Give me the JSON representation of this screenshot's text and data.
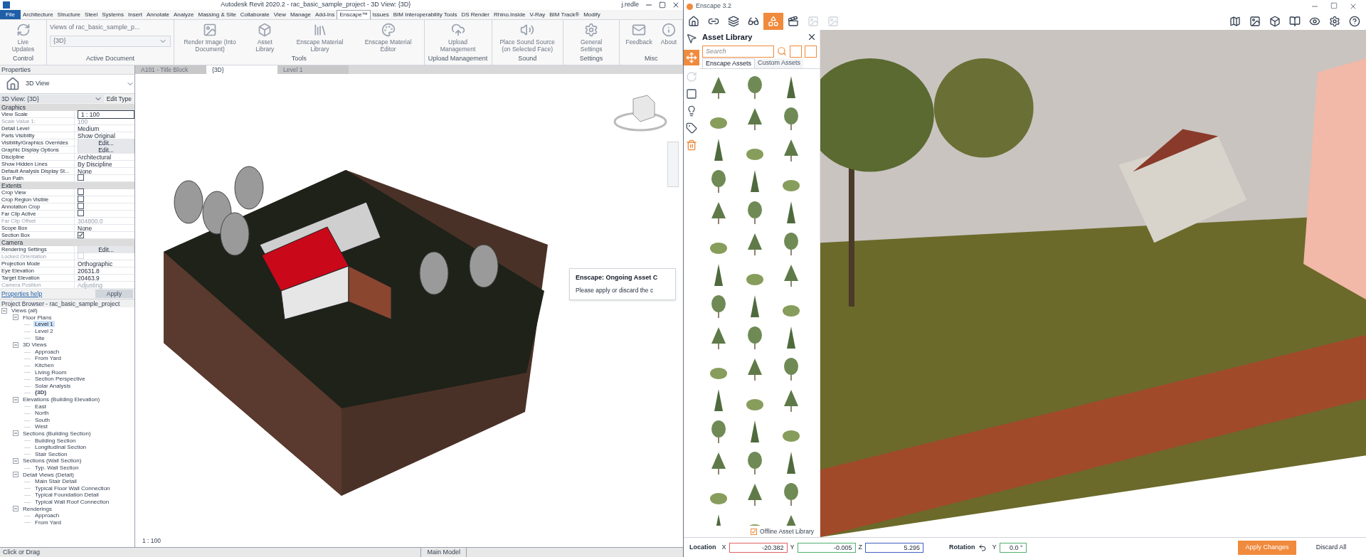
{
  "revit": {
    "title": "Autodesk Revit 2020.2 - rac_basic_sample_project - 3D View: {3D}",
    "user": "j.redle",
    "ribbon_tabs": [
      {
        "label": "File",
        "selected": false,
        "kind": "file"
      },
      {
        "label": "Architecture",
        "selected": false,
        "kind": "tab"
      },
      {
        "label": "Structure",
        "selected": false,
        "kind": "tab"
      },
      {
        "label": "Steel",
        "selected": false,
        "kind": "tab"
      },
      {
        "label": "Systems",
        "selected": false,
        "kind": "tab"
      },
      {
        "label": "Insert",
        "selected": false,
        "kind": "tab"
      },
      {
        "label": "Annotate",
        "selected": false,
        "kind": "tab"
      },
      {
        "label": "Analyze",
        "selected": false,
        "kind": "tab"
      },
      {
        "label": "Massing & Site",
        "selected": false,
        "kind": "tab"
      },
      {
        "label": "Collaborate",
        "selected": false,
        "kind": "tab"
      },
      {
        "label": "View",
        "selected": false,
        "kind": "tab"
      },
      {
        "label": "Manage",
        "selected": false,
        "kind": "tab"
      },
      {
        "label": "Add-Ins",
        "selected": false,
        "kind": "tab"
      },
      {
        "label": "Enscape™",
        "selected": true,
        "kind": "tab"
      },
      {
        "label": "Issues",
        "selected": false,
        "kind": "tab"
      },
      {
        "label": "BIM Interoperability Tools",
        "selected": false,
        "kind": "tab"
      },
      {
        "label": "DS Render",
        "selected": false,
        "kind": "tab"
      },
      {
        "label": "Rhino.Inside",
        "selected": false,
        "kind": "tab"
      },
      {
        "label": "V-Ray",
        "selected": false,
        "kind": "tab"
      },
      {
        "label": "BIM Track®",
        "selected": false,
        "kind": "tab"
      },
      {
        "label": "Modify",
        "selected": false,
        "kind": "tab"
      }
    ],
    "ribbon_panels": [
      {
        "label": "Control",
        "kind": "tools",
        "tools": [
          {
            "label": "Live Updates"
          }
        ]
      },
      {
        "label": "Active Document",
        "kind": "document",
        "caption": "Views of  rac_basic_sample_p...",
        "value": "{3D}"
      },
      {
        "label": "Tools",
        "kind": "tools",
        "tools": [
          {
            "label": "Render Image (Into Document)"
          },
          {
            "label": "Asset Library"
          },
          {
            "label": "Enscape Material Library"
          },
          {
            "label": "Enscape Material Editor"
          }
        ]
      },
      {
        "label": "Upload Management",
        "kind": "tools",
        "tools": [
          {
            "label": "Upload Management"
          }
        ]
      },
      {
        "label": "Sound",
        "kind": "tools",
        "tools": [
          {
            "label": "Place Sound Source (on Selected Face)"
          }
        ]
      },
      {
        "label": "Settings",
        "kind": "tools",
        "tools": [
          {
            "label": "General Settings"
          }
        ]
      },
      {
        "label": "Misc",
        "kind": "tools",
        "tools": [
          {
            "label": "Feedback"
          },
          {
            "label": "About"
          }
        ]
      }
    ],
    "properties": {
      "title": "Properties",
      "type_name": "3D View",
      "view_selector": "3D View: {3D}",
      "edit_type": "Edit Type",
      "sections": [
        {
          "name": "Graphics",
          "rows": [
            {
              "label": "View Scale",
              "value": "1 : 100",
              "kind": "field",
              "disabled": false
            },
            {
              "label": "Scale Value    1:",
              "value": "100",
              "kind": "text",
              "disabled": true
            },
            {
              "label": "Detail Level",
              "value": "Medium",
              "kind": "text",
              "disabled": false
            },
            {
              "label": "Parts Visibility",
              "value": "Show Original",
              "kind": "text",
              "disabled": false
            },
            {
              "label": "Visibility/Graphics Overrides",
              "value": "Edit...",
              "kind": "button",
              "disabled": false
            },
            {
              "label": "Graphic Display Options",
              "value": "Edit...",
              "kind": "button",
              "disabled": false
            },
            {
              "label": "Discipline",
              "value": "Architectural",
              "kind": "text",
              "disabled": false
            },
            {
              "label": "Show Hidden Lines",
              "value": "By Discipline",
              "kind": "text",
              "disabled": false
            },
            {
              "label": "Default Analysis Display St...",
              "value": "None",
              "kind": "text",
              "disabled": false
            },
            {
              "label": "Sun Path",
              "kind": "checkbox",
              "disabled": false,
              "checked": false
            }
          ]
        },
        {
          "name": "Extents",
          "rows": [
            {
              "label": "Crop View",
              "kind": "checkbox",
              "disabled": false,
              "checked": false
            },
            {
              "label": "Crop Region Visible",
              "kind": "checkbox",
              "disabled": false,
              "checked": false
            },
            {
              "label": "Annotation Crop",
              "kind": "checkbox",
              "disabled": false,
              "checked": false
            },
            {
              "label": "Far Clip Active",
              "kind": "checkbox",
              "disabled": false,
              "checked": false
            },
            {
              "label": "Far Clip Offset",
              "value": "304800.0",
              "kind": "text",
              "disabled": true
            },
            {
              "label": "Scope Box",
              "value": "None",
              "kind": "text",
              "disabled": false
            },
            {
              "label": "Section Box",
              "kind": "checkbox",
              "disabled": false,
              "checked": true
            }
          ]
        },
        {
          "name": "Camera",
          "rows": [
            {
              "label": "Rendering Settings",
              "value": "Edit...",
              "kind": "button",
              "disabled": false
            },
            {
              "label": "Locked Orientation",
              "kind": "checkbox",
              "disabled": true,
              "checked": false
            },
            {
              "label": "Projection Mode",
              "value": "Orthographic",
              "kind": "text",
              "disabled": false
            },
            {
              "label": "Eye Elevation",
              "value": "20631.8",
              "kind": "text",
              "disabled": false
            },
            {
              "label": "Target Elevation",
              "value": "20463.9",
              "kind": "text",
              "disabled": false
            },
            {
              "label": "Camera Position",
              "value": "Adjusting",
              "kind": "text",
              "disabled": true
            }
          ]
        }
      ],
      "help_link": "Properties help",
      "apply": "Apply"
    },
    "view_tabs": [
      {
        "label": "A101 - Title Block",
        "selected": false
      },
      {
        "label": "{3D}",
        "selected": true
      },
      {
        "label": "Level 1",
        "selected": false
      }
    ],
    "project_browser": {
      "title": "Project Browser - rac_basic_sample_project",
      "tree": [
        {
          "label": "Views (all)",
          "expanded": true,
          "selected": false,
          "children": [
            {
              "label": "Floor Plans",
              "expanded": true,
              "selected": false,
              "children": [
                {
                  "label": "Level 1",
                  "selected": true
                },
                {
                  "label": "Level 2",
                  "selected": false
                },
                {
                  "label": "Site",
                  "selected": false
                }
              ]
            },
            {
              "label": "3D Views",
              "expanded": true,
              "selected": false,
              "children": [
                {
                  "label": "Approach",
                  "selected": false
                },
                {
                  "label": "From Yard",
                  "selected": false
                },
                {
                  "label": "Kitchen",
                  "selected": false
                },
                {
                  "label": "Living Room",
                  "selected": false
                },
                {
                  "label": "Section Perspective",
                  "selected": false
                },
                {
                  "label": "Solar Analysis",
                  "selected": false
                },
                {
                  "label": "{3D}",
                  "selected": false,
                  "bold": true
                }
              ]
            },
            {
              "label": "Elevations (Building Elevation)",
              "expanded": true,
              "selected": false,
              "children": [
                {
                  "label": "East",
                  "selected": false
                },
                {
                  "label": "North",
                  "selected": false
                },
                {
                  "label": "South",
                  "selected": false
                },
                {
                  "label": "West",
                  "selected": false
                }
              ]
            },
            {
              "label": "Sections (Building Section)",
              "expanded": true,
              "selected": false,
              "children": [
                {
                  "label": "Building Section",
                  "selected": false
                },
                {
                  "label": "Longitudinal Section",
                  "selected": false
                },
                {
                  "label": "Stair Section",
                  "selected": false
                }
              ]
            },
            {
              "label": "Sections (Wall Section)",
              "expanded": true,
              "selected": false,
              "children": [
                {
                  "label": "Typ. Wall Section",
                  "selected": false
                }
              ]
            },
            {
              "label": "Detail Views (Detail)",
              "expanded": true,
              "selected": false,
              "children": [
                {
                  "label": "Main Stair Detail",
                  "selected": false
                },
                {
                  "label": "Typical Floor Wall Connection",
                  "selected": false
                },
                {
                  "label": "Typical Foundation Detail",
                  "selected": false
                },
                {
                  "label": "Typical Wall Roof Connection",
                  "selected": false
                }
              ]
            },
            {
              "label": "Renderings",
              "expanded": true,
              "selected": false,
              "children": [
                {
                  "label": "Approach",
                  "selected": false
                },
                {
                  "label": "From Yard",
                  "selected": false
                }
              ]
            }
          ]
        }
      ]
    },
    "dialog": {
      "title": "Enscape: Ongoing Asset C",
      "message": "Please apply or discard the c"
    },
    "view_scale": "1 : 100",
    "status": "Click or Drag",
    "model": "Main Model"
  },
  "enscape": {
    "title": "Enscape 3.2",
    "asset_library": {
      "title": "Asset Library",
      "search": {
        "placeholder": "Search"
      },
      "tabs": [
        {
          "label": "Enscape Assets",
          "selected": true
        },
        {
          "label": "Custom Assets",
          "selected": false
        }
      ],
      "offline": {
        "label": "Offline Asset Library",
        "checked": true
      }
    },
    "location": {
      "label": "Location",
      "fields": [
        {
          "axis": "X",
          "value": "-20.382",
          "color": "#e06060"
        },
        {
          "axis": "Y",
          "value": "-0.005",
          "color": "#50b070"
        },
        {
          "axis": "Z",
          "value": "5.295",
          "color": "#4060c0"
        }
      ]
    },
    "rotation": {
      "label": "Rotation",
      "axis": "Y",
      "value": "0.0 °"
    },
    "buttons": [
      {
        "label": "Apply Changes",
        "kind": "primary"
      },
      {
        "label": "Discard All",
        "kind": "plain"
      }
    ]
  }
}
